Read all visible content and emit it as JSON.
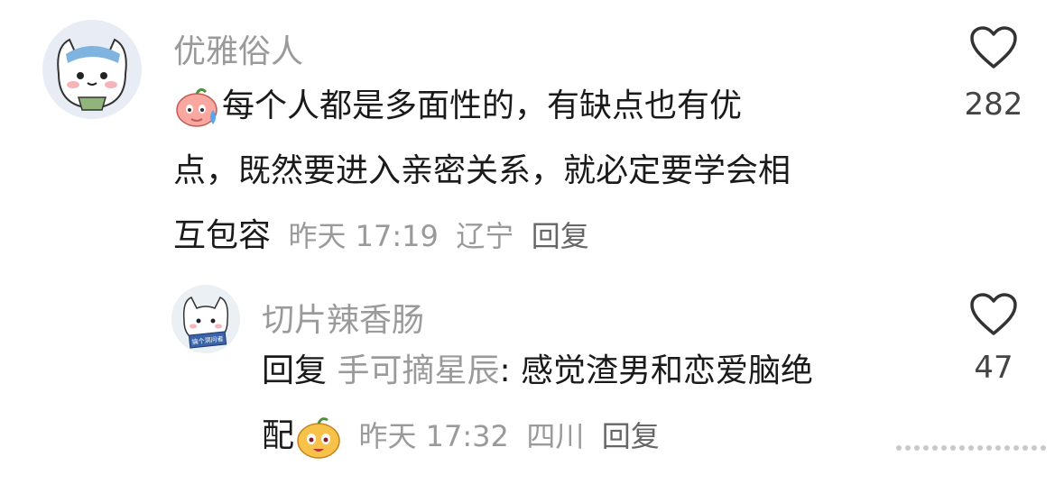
{
  "comments": [
    {
      "username": "优雅俗人",
      "line1": "每个人都是多面性的，有缺点也有优",
      "line2": "点，既然要进入亲密关系，就必定要学会相",
      "line3": "互包容",
      "time": "昨天 17:19",
      "location": "辽宁",
      "reply_label": "回复",
      "likes": "282",
      "avatar_icon": "cat-with-teacup-avatar",
      "emoji_icon": "sweating-face-sticker"
    }
  ],
  "reply": {
    "username": "切片辣香肠",
    "prefix": "回复",
    "target": "手可摘星辰",
    "text": ": 感觉渣男和恋爱脑绝",
    "text2": "配",
    "time": "昨天 17:32",
    "location": "四川",
    "reply_label": "回复",
    "likes": "47",
    "avatar_icon": "cat-holding-sign-avatar",
    "avatar_sign_text": "搞个洞问者",
    "emoji_icon": "round-face-sticker"
  },
  "colors": {
    "meta": "#9a9a9a",
    "text": "#1a1a1a",
    "heart": "#333333"
  }
}
